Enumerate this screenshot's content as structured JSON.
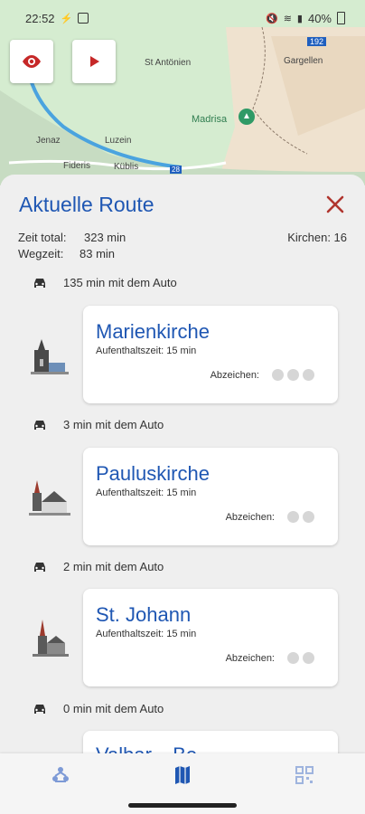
{
  "status": {
    "time": "22:52",
    "battery": "40%"
  },
  "map": {
    "labels": [
      "St Antönien",
      "Gargellen",
      "Madrisa",
      "Jenaz",
      "Luzein",
      "Fideris",
      "Küblis",
      "192",
      "28"
    ]
  },
  "route": {
    "title": "Aktuelle Route",
    "total_label": "Zeit total:",
    "total_value": "323 min",
    "walk_label": "Wegzeit:",
    "walk_value": "83 min",
    "churches": "Kirchen: 16",
    "legs": [
      "135 min mit dem Auto",
      "3 min mit dem Auto",
      "2 min mit dem Auto",
      "0 min mit dem Auto"
    ],
    "stops": [
      {
        "name": "Marienkirche",
        "stay": "Aufenthaltszeit: 15 min",
        "badge_label": "Abzeichen:"
      },
      {
        "name": "Pauluskirche",
        "stay": "Aufenthaltszeit: 15 min",
        "badge_label": "Abzeichen:"
      },
      {
        "name": "St. Johann",
        "stay": "Aufenthaltszeit: 15 min",
        "badge_label": "Abzeichen:"
      },
      {
        "name": "Valbar... Be...",
        "stay": "",
        "badge_label": ""
      }
    ]
  },
  "colors": {
    "accent": "#1f57b3",
    "close": "#b0352e",
    "eye": "#c62828"
  },
  "icons": [
    "eye-icon",
    "play-icon",
    "close-icon",
    "car-icon",
    "church-network-icon",
    "map-icon",
    "qr-code-icon"
  ]
}
